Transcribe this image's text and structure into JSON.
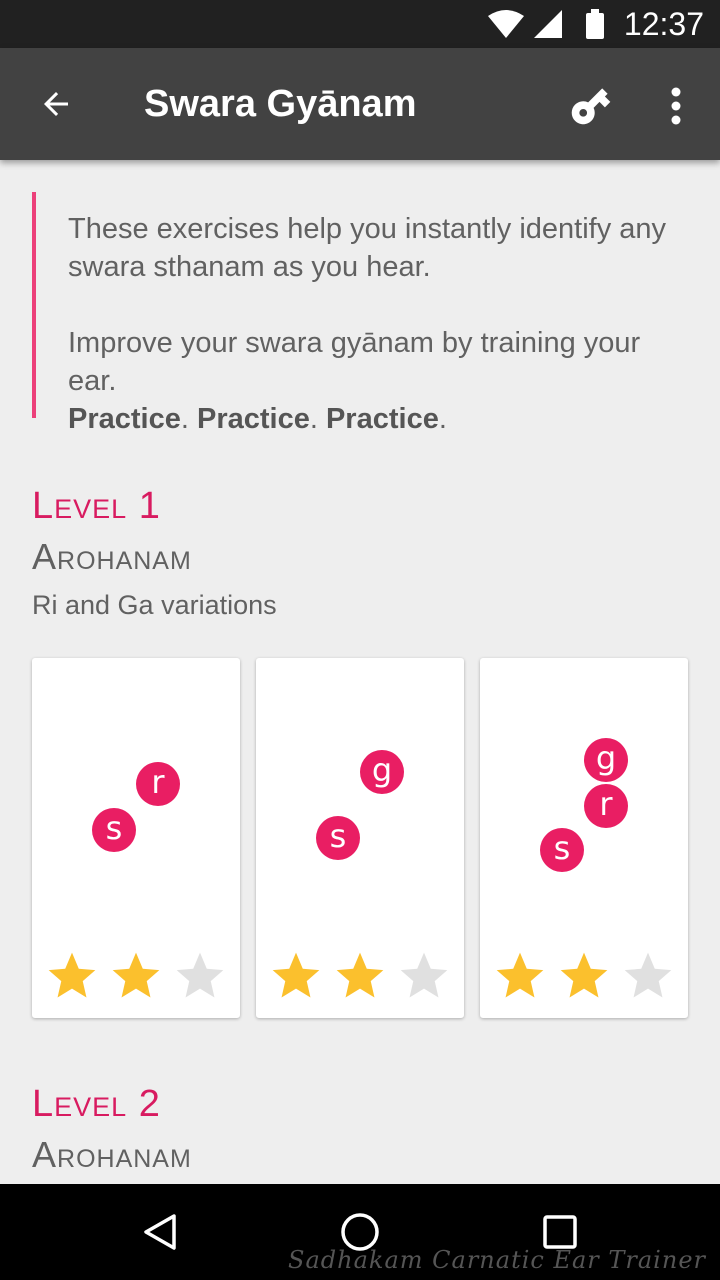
{
  "status_bar": {
    "time": "12:37",
    "icons": [
      "wifi-icon",
      "cell-signal-icon",
      "battery-icon"
    ]
  },
  "app_bar": {
    "title": "Swara Gyānam",
    "back_icon": "arrow-back-icon",
    "key_icon": "key-icon",
    "more_icon": "more-vert-icon"
  },
  "intro": {
    "line1": "These exercises help you instantly identify any swara sthanam as you hear.",
    "line2": "Improve your swara gyānam by training your ear.",
    "practice_word": "Practice",
    "separator": ".",
    "accent_color": "#ec407a"
  },
  "levels": [
    {
      "heading": "Level 1",
      "title": "Arohanam",
      "description": "Ri and Ga variations",
      "cards": [
        {
          "notes": [
            "s",
            "r"
          ],
          "stars_filled": 2,
          "stars_total": 3
        },
        {
          "notes": [
            "s",
            "g"
          ],
          "stars_filled": 2,
          "stars_total": 3
        },
        {
          "notes": [
            "s",
            "r",
            "g"
          ],
          "stars_filled": 2,
          "stars_total": 3
        }
      ]
    },
    {
      "heading": "Level 2",
      "title": "Arohanam"
    }
  ],
  "nav_bar": {
    "back_icon": "nav-back-icon",
    "home_icon": "nav-home-icon",
    "recents_icon": "nav-recents-icon"
  },
  "watermark": "Sadhakam Carnatic Ear Trainer",
  "colors": {
    "accent": "#e91e63",
    "heading": "#d81b60",
    "star_filled": "#fbc02d",
    "star_empty": "#e0e0e0",
    "app_bar": "#424242",
    "status_bar": "#212121"
  }
}
